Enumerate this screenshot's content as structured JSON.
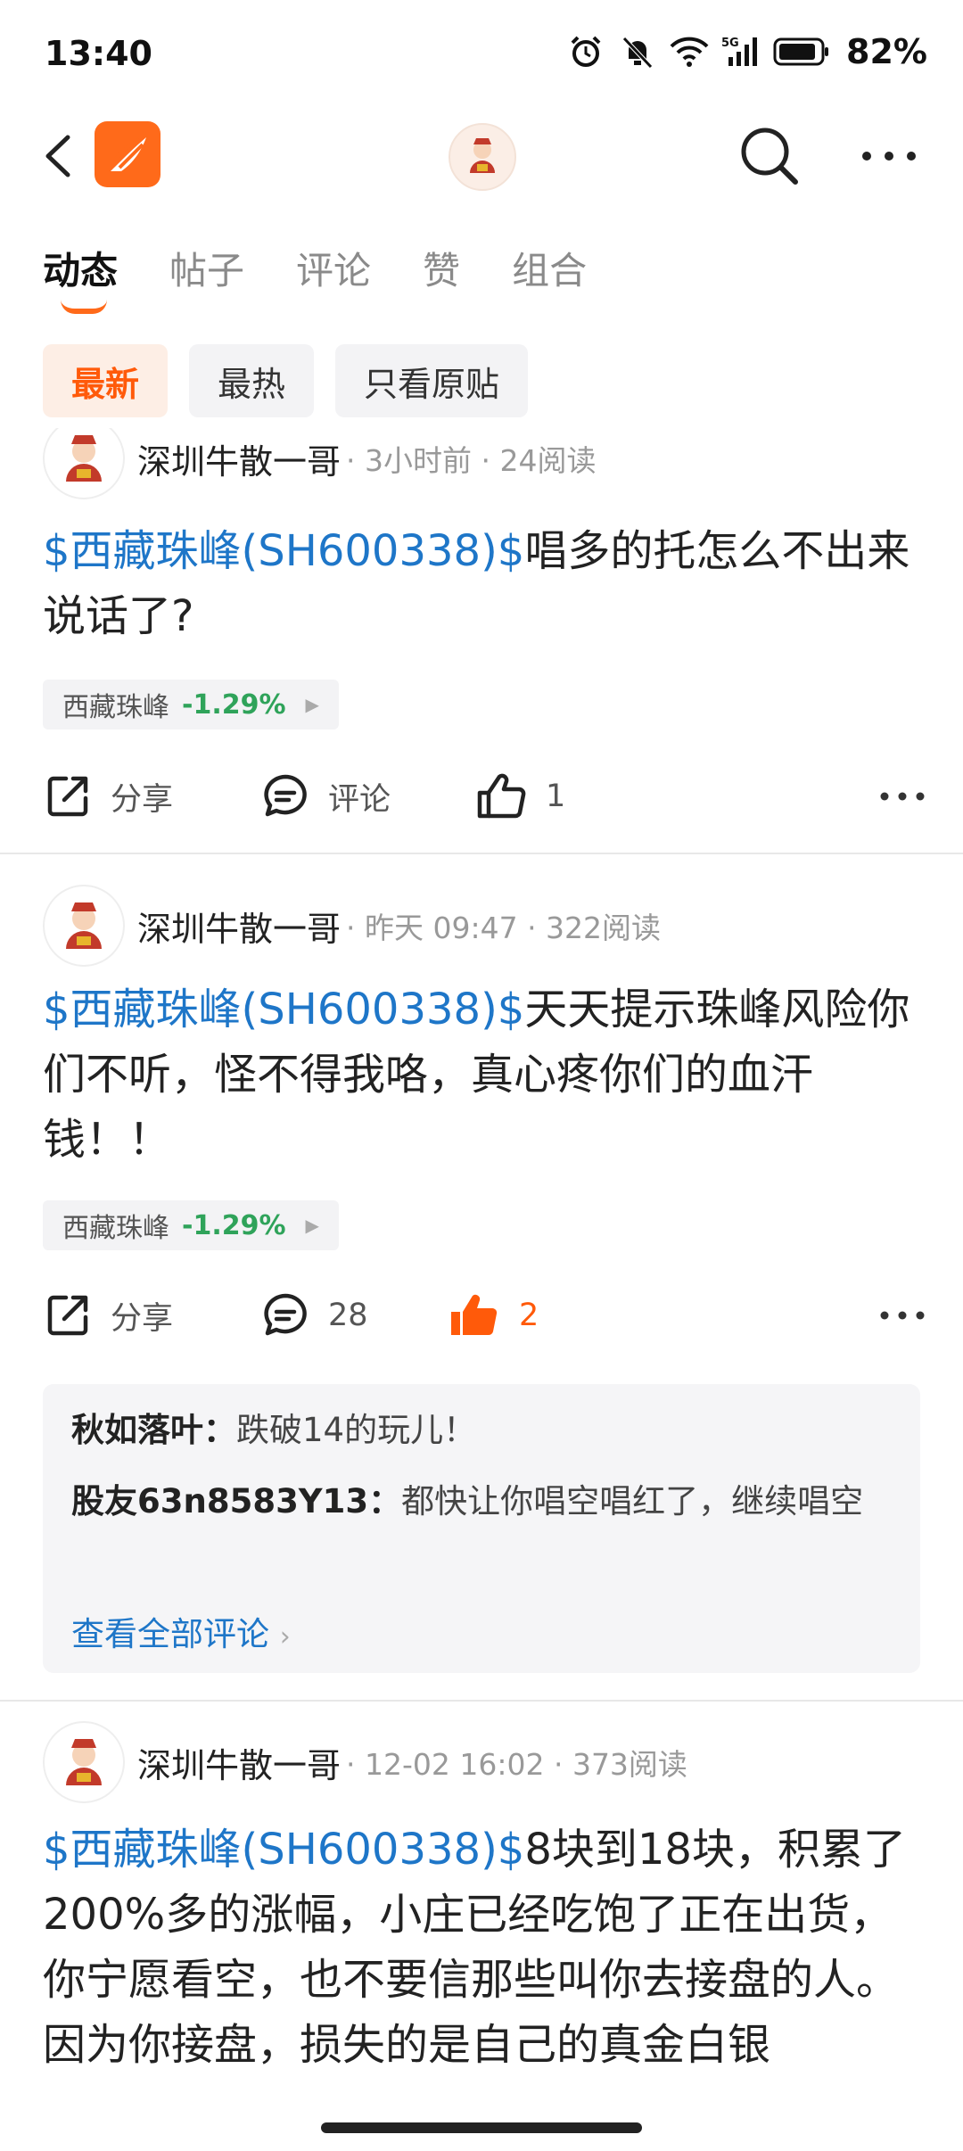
{
  "status_bar": {
    "time": "13:40",
    "battery": "82%"
  },
  "tabs": [
    {
      "label": "动态",
      "active": true
    },
    {
      "label": "帖子",
      "active": false
    },
    {
      "label": "评论",
      "active": false
    },
    {
      "label": "赞",
      "active": false
    },
    {
      "label": "组合",
      "active": false
    }
  ],
  "filters": [
    {
      "label": "最新",
      "active": true
    },
    {
      "label": "最热",
      "active": false
    },
    {
      "label": "只看原贴",
      "active": false
    }
  ],
  "posts": [
    {
      "author": "深圳牛散一哥",
      "meta": "· 3小时前 · 24阅读",
      "tag": "$西藏珠峰(SH600338)$",
      "text": "唱多的托怎么不出来说话了?",
      "stock": {
        "name": "西藏珠峰",
        "change": "-1.29%"
      },
      "share_label": "分享",
      "comment_label": "评论",
      "like_count": "1"
    },
    {
      "author": "深圳牛散一哥",
      "meta": "· 昨天 09:47 · 322阅读",
      "tag": "$西藏珠峰(SH600338)$",
      "text": "天天提示珠峰风险你们不听，怪不得我咯，真心疼你们的血汗钱！！",
      "stock": {
        "name": "西藏珠峰",
        "change": "-1.29%"
      },
      "share_label": "分享",
      "comment_label": "28",
      "like_count": "2",
      "comments": [
        {
          "user": "秋如落叶：",
          "text": "跌破14的玩儿！"
        },
        {
          "user": "股友63n8583Y13：",
          "text": "都快让你唱空唱红了，继续唱空"
        }
      ],
      "see_all": "查看全部评论"
    },
    {
      "author": "深圳牛散一哥",
      "meta": "· 12-02 16:02 · 373阅读",
      "tag": "$西藏珠峰(SH600338)$",
      "text": "8块到18块，积累了200%多的涨幅，小庄已经吃饱了正在出货，你宁愿看空，也不要信那些叫你去接盘的人。因为你接盘，损失的是自己的真金白银"
    }
  ],
  "colors": {
    "accent": "#ff6a1a",
    "link": "#1e76c8",
    "down": "#2fa35a"
  }
}
